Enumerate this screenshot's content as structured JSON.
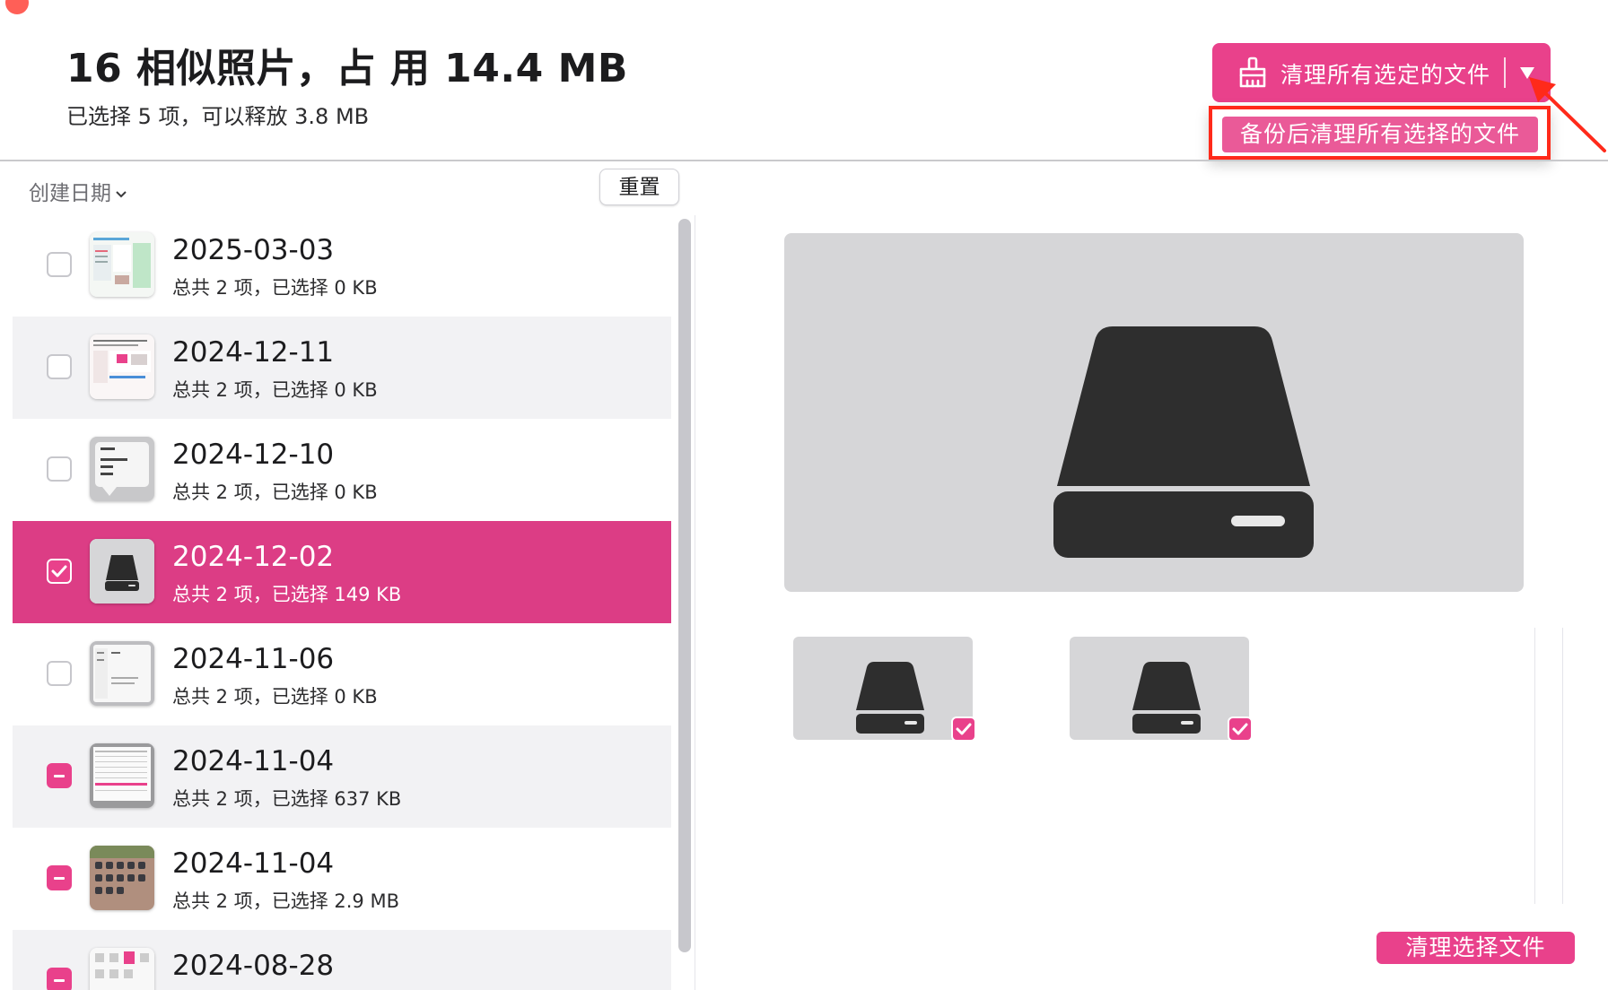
{
  "header": {
    "title": "16 相似照片，占 用 14.4 MB",
    "subtitle": "已选择 5 项，可以释放 3.8 MB"
  },
  "toolbar": {
    "clean_all_label": "清理所有选定的文件",
    "dropdown_item": "备份后清理所有选择的文件"
  },
  "list_header": {
    "sort_label": "创建日期",
    "reset_label": "重置"
  },
  "groups": [
    {
      "date": "2025-03-03",
      "info": "总共 2 项，已选择 0 KB",
      "state": "unchecked"
    },
    {
      "date": "2024-12-11",
      "info": "总共 2 项，已选择 0 KB",
      "state": "unchecked"
    },
    {
      "date": "2024-12-10",
      "info": "总共 2 项，已选择 0 KB",
      "state": "unchecked"
    },
    {
      "date": "2024-12-02",
      "info": "总共 2 项，已选择 149 KB",
      "state": "checked"
    },
    {
      "date": "2024-11-06",
      "info": "总共 2 项，已选择 0 KB",
      "state": "unchecked"
    },
    {
      "date": "2024-11-04",
      "info": "总共 2 项，已选择 637 KB",
      "state": "partial"
    },
    {
      "date": "2024-11-04",
      "info": "总共 2 项，已选择 2.9 MB",
      "state": "partial"
    },
    {
      "date": "2024-08-28",
      "info": "",
      "state": "partial"
    }
  ],
  "footer": {
    "clean_selected_label": "清理选择文件"
  },
  "colors": {
    "accent": "#e9418b",
    "selected_row": "#dc3d85",
    "highlight_border": "#ff2a1a"
  }
}
